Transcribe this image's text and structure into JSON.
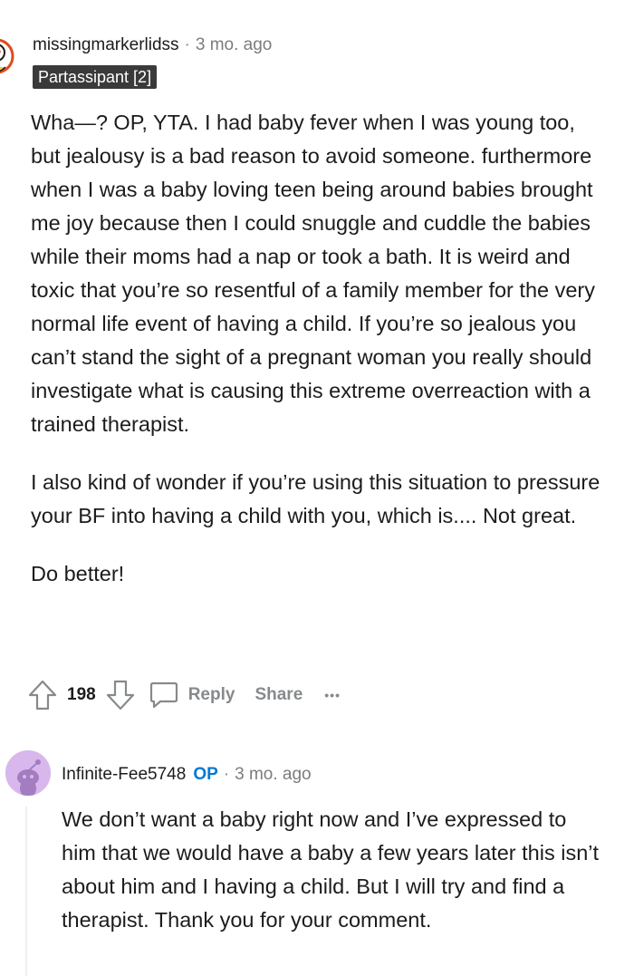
{
  "comments": [
    {
      "username": "missingmarkerlidss",
      "time": "3 mo. ago",
      "flair": "Partassipant [2]",
      "paragraphs": [
        "Wha—? OP, YTA. I had baby fever when I was young too, but jealousy is a bad reason to avoid someone. furthermore when I was a baby loving teen being around babies brought me joy because then I could snuggle and cuddle the babies while their moms had a nap or took a bath. It is weird and toxic that you’re so resentful of a family member for the very normal life event of having a child. If you’re so jealous you can’t stand the sight of a pregnant woman you really should investigate what is causing this extreme overreaction with a trained therapist.",
        "I also kind of wonder if you’re using this situation to pressure your BF into having a child with you, which is.... Not great.",
        "Do better!"
      ],
      "score": "198",
      "reply_label": "Reply",
      "share_label": "Share",
      "more_label": "•••"
    },
    {
      "username": "Infinite-Fee5748",
      "op_badge": "OP",
      "time": "3 mo. ago",
      "text": "We don’t want a baby right now and I’ve expressed to him that we would have a baby a few years later this isn’t about him and I having a child. But I will try and find a therapist. Thank you for your comment."
    }
  ],
  "separator": "·",
  "colors": {
    "text": "#1c1c1c",
    "meta": "#7c7c7c",
    "action": "#878a8c",
    "flair_bg": "#3a3a3a",
    "op": "#0079d3",
    "avatar_bg": "#d8b8ec"
  }
}
